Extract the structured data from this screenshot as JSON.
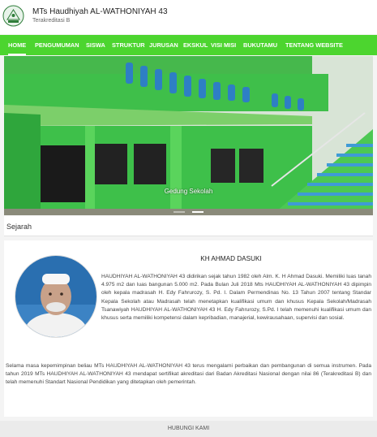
{
  "header": {
    "title": "MTs Haudhiyah AL-WATHONIYAH 43",
    "subtitle": "Terakreditasi B",
    "logo_icon": "school-logo-icon"
  },
  "nav": {
    "items": [
      {
        "label": "HOME",
        "active": true
      },
      {
        "label": "PENGUMUMAN"
      },
      {
        "label": "SISWA"
      },
      {
        "label": "STRUKTUR"
      },
      {
        "label": "JURUSAN"
      },
      {
        "label": "EKSKUL"
      },
      {
        "label": "VISI MISI"
      },
      {
        "label": "BUKUTAMU"
      },
      {
        "label": "TENTANG WEBSITE"
      }
    ],
    "color": "#4cd52f"
  },
  "slider": {
    "caption": "Gedung Sekolah",
    "slide_count": 2,
    "active_index": 1
  },
  "section": {
    "title": "Sejarah"
  },
  "history": {
    "person_name": "KH AHMAD DASUKI",
    "paragraph1": "HAUDHIYAH AL-WATHONIYAH 43 didirikan sejak tahun 1982 oleh Alm. K. H Ahmad Dasuki. Memiliki luas tanah 4.975 m2 dan luas bangunan 5.000 m2. Pada Bulan Juli 2018 Mts HAUDHIYAH AL-WATHONIYAH 43 dipimpin oleh kepala madrasah H. Edy Fahrurozy, S. Pd. I. Dalam Permendinas No. 13 Tahun 2007 tentang Standar Kepala Sekolah atau Madrasah telah menetapkan kualifikasi umum dan khusus Kepala Sekolah/Madrasah Tsanawiyah HAUDHIYAH AL-WATHONIYAH 43 H. Edy Fahrurozy, S.Pd. I telah memenuhi kualifikasi umum dan khusus serta memiliki kompetensi dalam kepribadian, manajerial, kewirausahaan, supervisi dan sosial.",
    "paragraph2": "Selama masa kepemimpinan beliau MTs HAUDHIYAH AL-WATHONIYAH 43 terus mengalami perbaikan dan pembangunan di semua instrumen. Pada tahun 2019 MTs HAUDHIYAH AL-WATHONIYAH 43 mendapat sertifikat akreditasi dari Badan Akreditasi Nasional dengan nilai 86 (Terakreditasi B) dan telah memenuhi Standart Nasional Pendidikan yang ditetapkan oleh pemerintah."
  },
  "footer": {
    "label": "HUBUNGI KAMI"
  }
}
